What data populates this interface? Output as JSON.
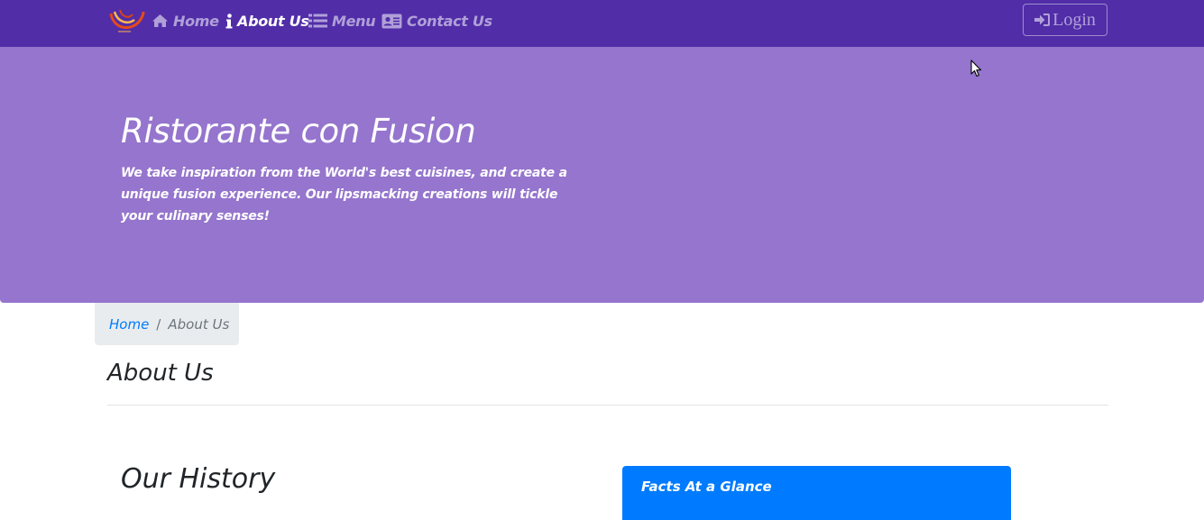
{
  "navbar": {
    "bg_color": "#512da8",
    "logo_icon": "restaurant-logo",
    "items": [
      {
        "label": "Home",
        "icon": "home-icon",
        "active": false
      },
      {
        "label": "About Us",
        "icon": "info-icon",
        "active": true
      },
      {
        "label": "Menu",
        "icon": "list-icon",
        "active": false
      },
      {
        "label": "Contact Us",
        "icon": "address-card-icon",
        "active": false
      }
    ],
    "login": {
      "label": "Login",
      "icon": "sign-in-icon"
    }
  },
  "jumbotron": {
    "bg_color": "#9575cd",
    "title": "Ristorante con Fusion",
    "text": "We take inspiration from the World's best cuisines, and create a unique fusion experience. Our lipsmacking creations will tickle your culinary senses!"
  },
  "breadcrumb": {
    "items": [
      {
        "label": "Home",
        "link": true
      },
      {
        "label": "About Us",
        "link": false
      }
    ],
    "separator": "/"
  },
  "main": {
    "page_heading": "About Us",
    "section_heading": "Our History",
    "facts_card": {
      "header": "Facts At a Glance",
      "color": "#007bff"
    }
  }
}
